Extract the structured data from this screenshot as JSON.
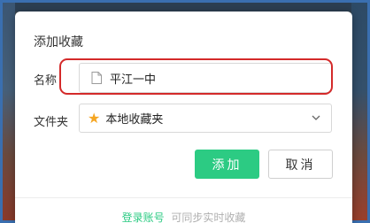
{
  "dialog": {
    "title": "添加收藏",
    "name_label": "名称",
    "name_value": "平江一中",
    "folder_label": "文件夹",
    "folder_value": "本地收藏夹",
    "add_label": "添加",
    "cancel_label": "取消",
    "footer_link": "登录账号",
    "footer_text": "可同步实时收藏"
  },
  "icons": {
    "name_field": "page-icon",
    "folder_field": "star-icon",
    "folder_dropdown": "chevron-down-icon"
  },
  "colors": {
    "accent_green": "#2ccb83",
    "star_orange": "#f5a623",
    "annotation_red": "#d42a2a",
    "window_border_blue": "#3a6fb0"
  }
}
